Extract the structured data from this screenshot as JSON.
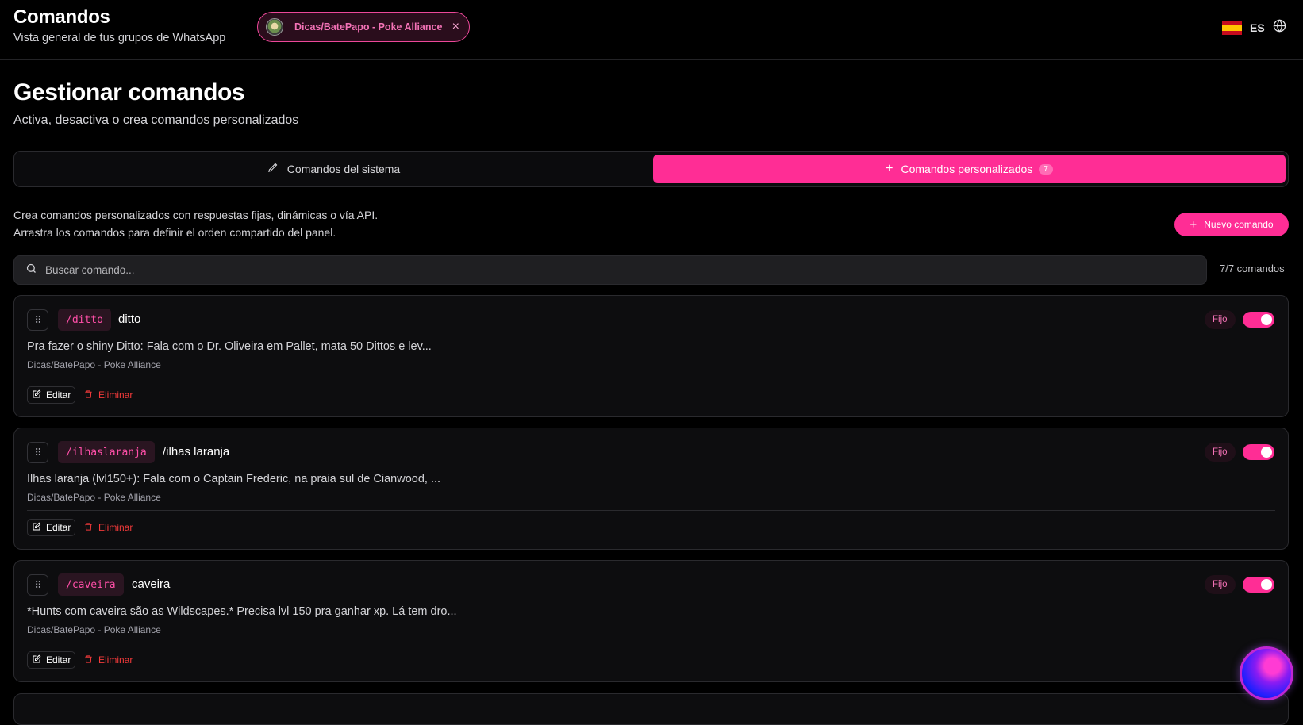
{
  "header": {
    "title": "Comandos",
    "subtitle": "Vista general de tus grupos de WhatsApp",
    "group_chip": {
      "label": "Dicas/BatePapo - Poke Alliance",
      "close": "×"
    },
    "language": {
      "code": "ES",
      "flag": "spain-flag-icon"
    }
  },
  "page": {
    "title": "Gestionar comandos",
    "subtitle": "Activa, desactiva o crea comandos personalizados"
  },
  "tabs": {
    "system": {
      "label": "Comandos del sistema",
      "icon": "pencil-icon"
    },
    "custom": {
      "label": "Comandos personalizados",
      "icon": "plus-icon",
      "badge": "7",
      "active": true
    }
  },
  "description": {
    "line1": "Crea comandos personalizados con respuestas fijas, dinámicas o vía API.",
    "line2": "Arrastra los comandos para definir el orden compartido del panel."
  },
  "new_command_button": "Nuevo comando",
  "search": {
    "placeholder": "Buscar comando...",
    "value": ""
  },
  "count_label": "7/7 comandos",
  "commands": [
    {
      "trigger": "/ditto",
      "name": "ditto",
      "text": "Pra fazer o shiny Ditto: Fala com o Dr. Oliveira em Pallet, mata 50 Dittos e lev...",
      "group": "Dicas/BatePapo - Poke Alliance",
      "type_badge": "Fijo",
      "enabled": true,
      "edit_label": "Editar",
      "delete_label": "Eliminar"
    },
    {
      "trigger": "/ilhaslaranja",
      "name": "/ilhas laranja",
      "text": "Ilhas laranja (lvl150+): Fala com o Captain Frederic, na praia sul de Cianwood, ...",
      "group": "Dicas/BatePapo - Poke Alliance",
      "type_badge": "Fijo",
      "enabled": true,
      "edit_label": "Editar",
      "delete_label": "Eliminar"
    },
    {
      "trigger": "/caveira",
      "name": "caveira",
      "text": "*Hunts com caveira são as Wildscapes.* Precisa lvl 150 pra ganhar xp. Lá tem dro...",
      "group": "Dicas/BatePapo - Poke Alliance",
      "type_badge": "Fijo",
      "enabled": true,
      "edit_label": "Editar",
      "delete_label": "Eliminar"
    }
  ],
  "colors": {
    "accent": "#ff2d95",
    "background": "#000000",
    "card": "#0d0d0f",
    "danger": "#f23a3a"
  }
}
